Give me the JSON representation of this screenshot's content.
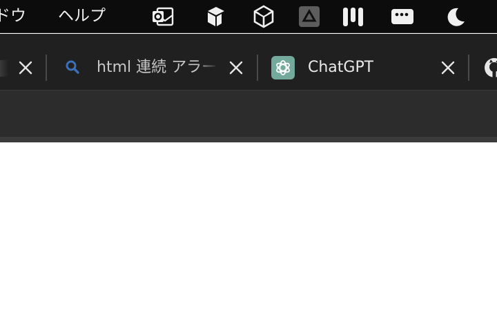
{
  "menubar": {
    "window_label": "ドウ",
    "help_label": "ヘルプ",
    "tray_icons": [
      "outlook-icon",
      "box-cube-icon",
      "unity-icon",
      "drive-triangle-icon",
      "notion-logo-icon",
      "window-dots-icon",
      "moon-icon"
    ]
  },
  "tabs": [
    {
      "title": "",
      "favicon": "none",
      "active": false
    },
    {
      "title": "html 連続 アラート",
      "favicon": "search-icon",
      "active": false
    },
    {
      "title": "ChatGPT",
      "favicon": "chatgpt-icon",
      "active": true
    },
    {
      "title": "",
      "favicon": "github-icon",
      "active": false
    }
  ],
  "colors": {
    "menubar_bg": "#0c0c0c",
    "tabbar_bg": "#202020",
    "toolbar_bg": "#2c2c2c",
    "chatgpt_favicon_bg": "#74aa9c",
    "search_icon": "#3d6fb6",
    "content_bg": "#ffffff"
  }
}
